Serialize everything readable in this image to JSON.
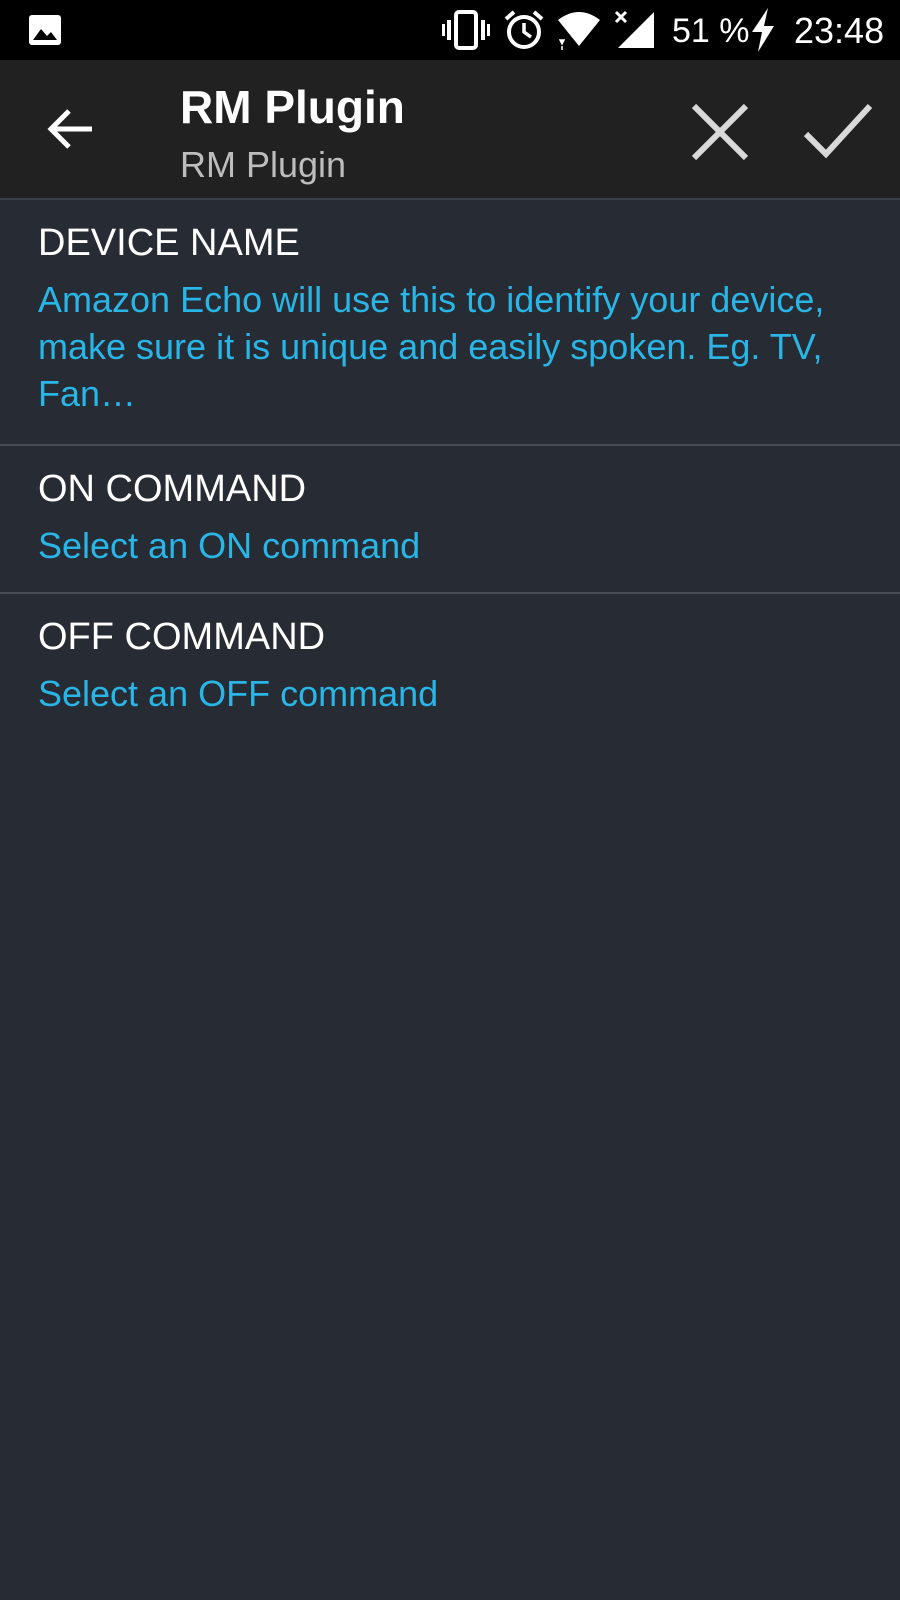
{
  "status_bar": {
    "battery_percent": "51 %",
    "time": "23:48",
    "icons": [
      "gallery-icon",
      "vibrate-icon",
      "alarm-icon",
      "wifi-icon",
      "signal-icon",
      "charging-icon"
    ]
  },
  "app_bar": {
    "title": "RM Plugin",
    "subtitle": "RM Plugin",
    "icons": [
      "back-arrow-icon",
      "close-icon",
      "check-icon"
    ]
  },
  "preferences": {
    "device_name": {
      "title": "DEVICE NAME",
      "summary": "Amazon Echo will use this to identify your device, make sure it is unique and easily spoken. Eg. TV, Fan…"
    },
    "on_command": {
      "title": "ON COMMAND",
      "summary": "Select an ON command"
    },
    "off_command": {
      "title": "OFF COMMAND",
      "summary": "Select an OFF command"
    }
  },
  "colors": {
    "background": "#272b33",
    "app_bar": "#212121",
    "status_bar": "#000000",
    "accent_summary": "#29b6e6",
    "title_text": "#ffffff",
    "subtitle_text": "#bdbdbd"
  }
}
